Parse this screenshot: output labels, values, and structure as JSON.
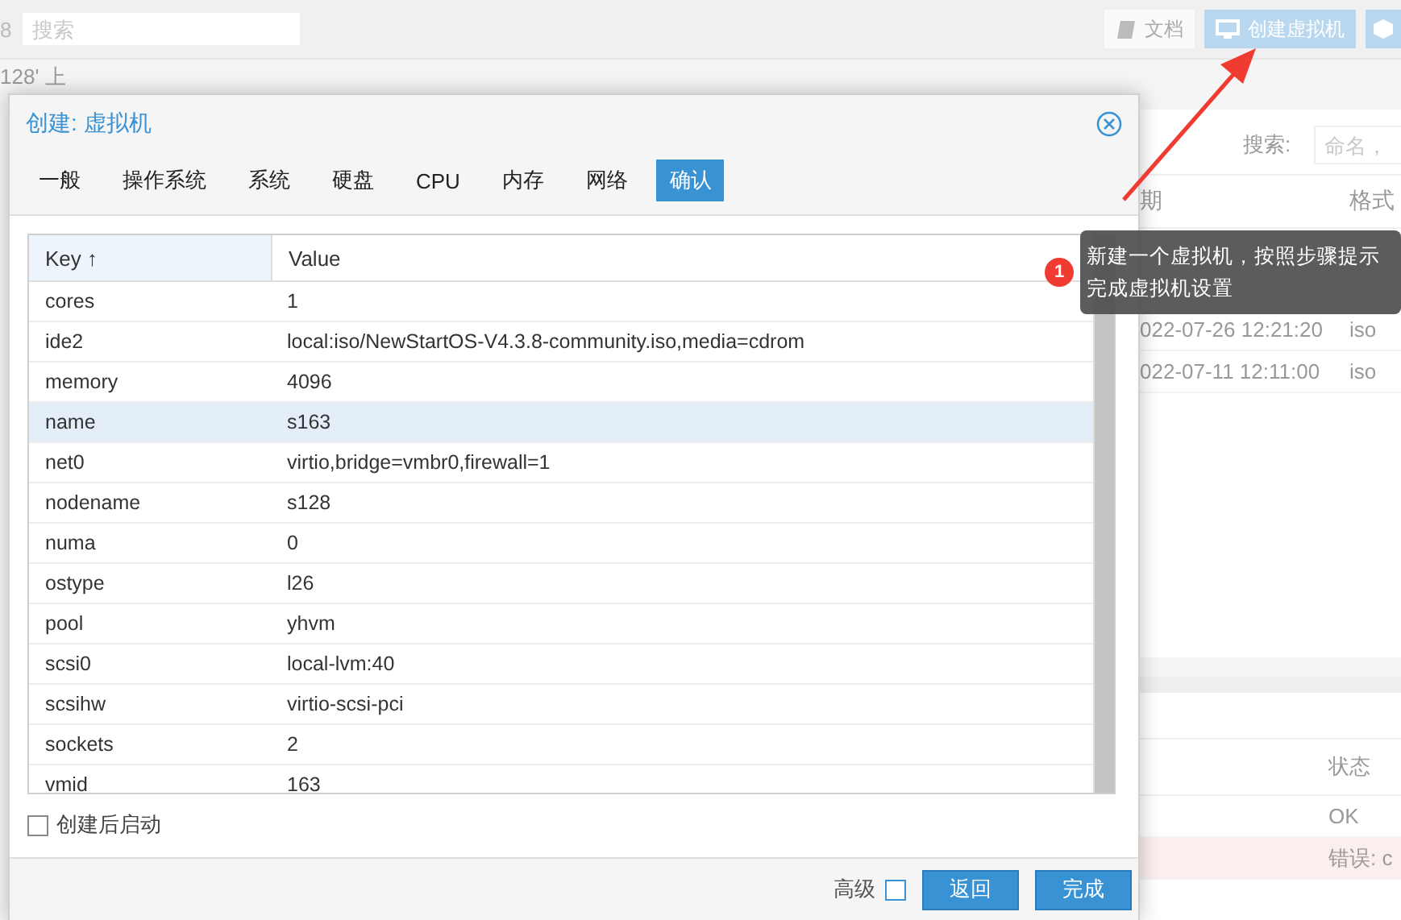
{
  "background": {
    "toolbar": {
      "node_text": "8",
      "search": {
        "placeholder": "搜索"
      },
      "buttons": [
        {
          "label": "文档",
          "kind": "doc",
          "selected": false
        },
        {
          "label": "创建虚拟机",
          "kind": "monitor",
          "selected": true
        },
        {
          "kind": "cube",
          "selected": true
        }
      ]
    },
    "breadcrumb": "128' 上",
    "panel": {
      "search_label": "搜索:",
      "search": {
        "placeholder": "命名，"
      },
      "columns": [
        "期",
        "格式"
      ],
      "rows": [
        {
          "date": "022-07-26 12:21:20",
          "format": "iso"
        },
        {
          "date": "022-07-11 12:11:00",
          "format": "iso"
        }
      ]
    },
    "log": {
      "columns": [
        "状态"
      ],
      "rows": [
        {
          "status": "OK",
          "error": false
        },
        {
          "status": "错误: c",
          "error": true
        }
      ]
    }
  },
  "dialog": {
    "title": "创建: 虚拟机",
    "tabs": [
      {
        "label": "一般",
        "selected": false
      },
      {
        "label": "操作系统",
        "selected": false
      },
      {
        "label": "系统",
        "selected": false
      },
      {
        "label": "硬盘",
        "selected": false
      },
      {
        "label": "CPU",
        "selected": false
      },
      {
        "label": "内存",
        "selected": false
      },
      {
        "label": "网络",
        "selected": false
      },
      {
        "label": "确认",
        "selected": true
      }
    ],
    "table": {
      "columns": [
        "Key ↑",
        "Value"
      ],
      "rows": [
        {
          "key": "cores",
          "value": "1",
          "selected": false
        },
        {
          "key": "ide2",
          "value": "local:iso/NewStartOS-V4.3.8-community.iso,media=cdrom",
          "selected": false
        },
        {
          "key": "memory",
          "value": "4096",
          "selected": false
        },
        {
          "key": "name",
          "value": "s163",
          "selected": true
        },
        {
          "key": "net0",
          "value": "virtio,bridge=vmbr0,firewall=1",
          "selected": false
        },
        {
          "key": "nodename",
          "value": "s128",
          "selected": false
        },
        {
          "key": "numa",
          "value": "0",
          "selected": false
        },
        {
          "key": "ostype",
          "value": "l26",
          "selected": false
        },
        {
          "key": "pool",
          "value": "yhvm",
          "selected": false
        },
        {
          "key": "scsi0",
          "value": "local-lvm:40",
          "selected": false
        },
        {
          "key": "scsihw",
          "value": "virtio-scsi-pci",
          "selected": false
        },
        {
          "key": "sockets",
          "value": "2",
          "selected": false
        },
        {
          "key": "vmid",
          "value": "163",
          "selected": false
        }
      ]
    },
    "start_after_create": {
      "label": "创建后启动",
      "checked": false
    },
    "advanced": {
      "label": "高级",
      "checked": false
    },
    "buttons": [
      "返回",
      "完成"
    ]
  },
  "callout": {
    "badge": "1",
    "text": "新建一个虚拟机，按照步骤提示完成虚拟机设置"
  }
}
